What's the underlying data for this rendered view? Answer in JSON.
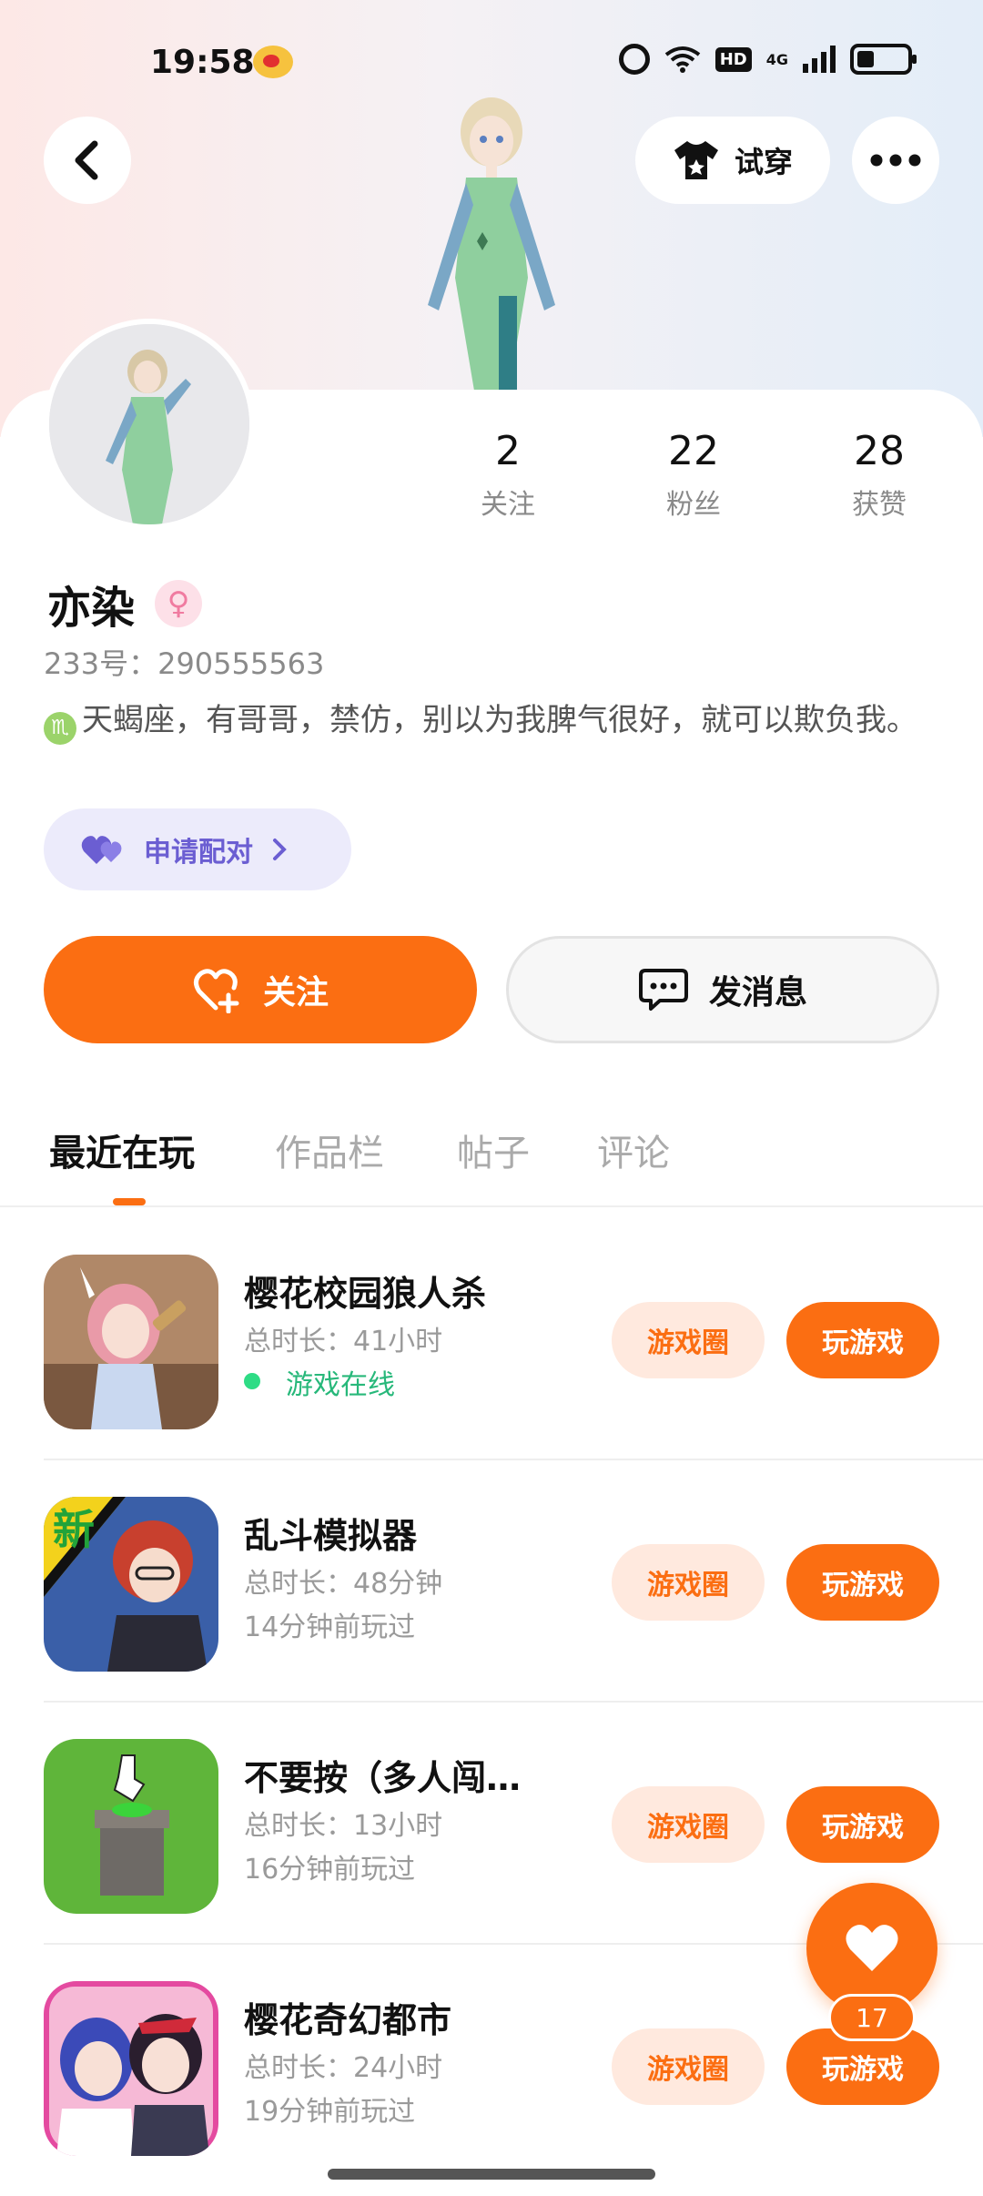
{
  "status_bar": {
    "time": "19:58",
    "icons": [
      "weibo-icon",
      "alarm-icon",
      "wifi-icon",
      "hd-icon",
      "4g-signal-icon",
      "battery-icon"
    ],
    "network_label": "4G",
    "hd_label": "HD"
  },
  "header": {
    "back_icon": "chevron-left-icon",
    "try_on_label": "试穿",
    "try_on_icon": "tshirt-icon",
    "more_icon": "more-dots-icon"
  },
  "profile": {
    "stats": [
      {
        "value": "2",
        "label": "关注"
      },
      {
        "value": "22",
        "label": "粉丝"
      },
      {
        "value": "28",
        "label": "获赞"
      }
    ],
    "name": "亦染",
    "gender_icon": "female-icon",
    "uid": "233号：290555563",
    "bio": "天蝎座，有哥哥，禁仿，别以为我脾气很好，就可以欺负我。",
    "zodiac_icon": "scorpio-icon",
    "match_label": "申请配对"
  },
  "actions": {
    "follow_label": "关注",
    "message_label": "发消息"
  },
  "tabs": [
    {
      "label": "最近在玩",
      "active": true
    },
    {
      "label": "作品栏",
      "active": false
    },
    {
      "label": "帖子",
      "active": false
    },
    {
      "label": "评论",
      "active": false
    }
  ],
  "games": [
    {
      "title": "樱花校园狼人杀",
      "duration": "总时长：41小时",
      "last": "游戏在线",
      "online": true,
      "circle_label": "游戏圈",
      "play_label": "玩游戏"
    },
    {
      "title": "乱斗模拟器",
      "duration": "总时长：48分钟",
      "last": "14分钟前玩过",
      "online": false,
      "circle_label": "游戏圈",
      "play_label": "玩游戏"
    },
    {
      "title": "不要按（多人闯…",
      "duration": "总时长：13小时",
      "last": "16分钟前玩过",
      "online": false,
      "circle_label": "游戏圈",
      "play_label": "玩游戏"
    },
    {
      "title": "樱花奇幻都市",
      "duration": "总时长：24小时",
      "last": "19分钟前玩过",
      "online": false,
      "circle_label": "游戏圈",
      "play_label": "玩游戏"
    }
  ],
  "game_badge": "新",
  "fab": {
    "icon": "heart-icon",
    "count": "17"
  },
  "colors": {
    "accent": "#fb6e12",
    "accent_light": "#ffe9de",
    "match_bg": "#ecebfb",
    "match_text": "#6b5ed2",
    "online": "#27b87a"
  }
}
